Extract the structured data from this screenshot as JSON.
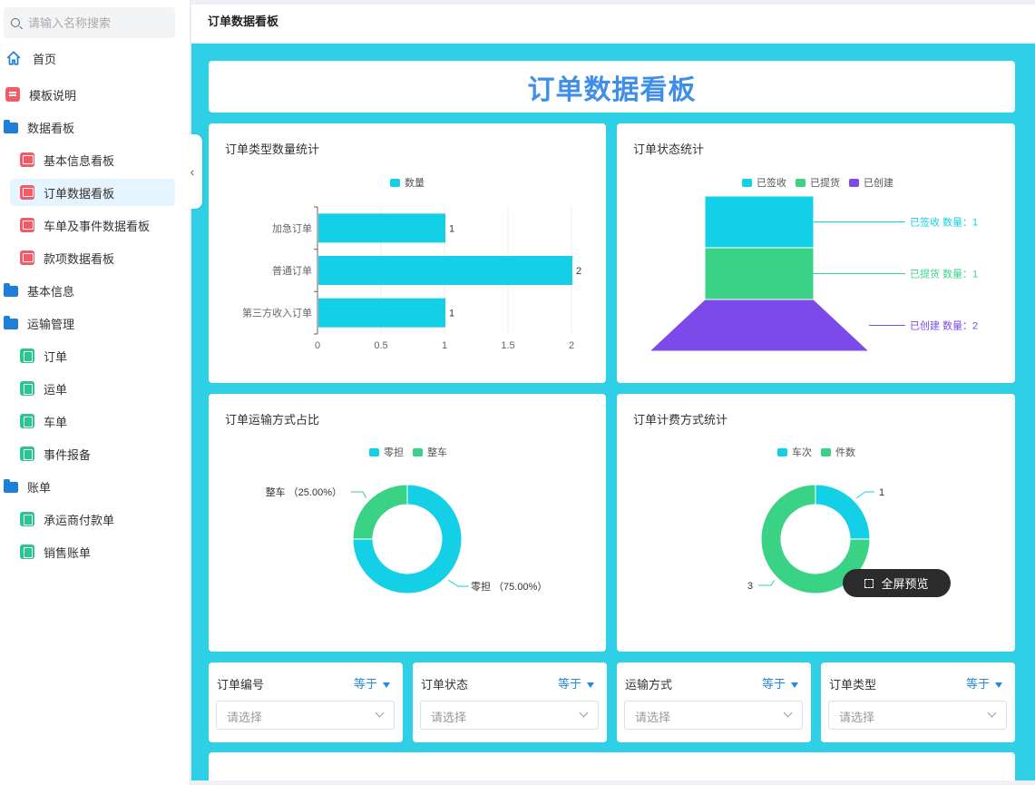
{
  "search": {
    "placeholder": "请输入名称搜索"
  },
  "sidebar": {
    "items": [
      {
        "label": "首页"
      },
      {
        "label": "模板说明"
      },
      {
        "label": "数据看板"
      },
      {
        "label": "基本信息看板"
      },
      {
        "label": "订单数据看板"
      },
      {
        "label": "车单及事件数据看板"
      },
      {
        "label": "款项数据看板"
      },
      {
        "label": "基本信息"
      },
      {
        "label": "运输管理"
      },
      {
        "label": "订单"
      },
      {
        "label": "运单"
      },
      {
        "label": "车单"
      },
      {
        "label": "事件报备"
      },
      {
        "label": "账单"
      },
      {
        "label": "承运商付款单"
      },
      {
        "label": "销售账单"
      }
    ],
    "collapse_glyph": "‹"
  },
  "header": {
    "title": "订单数据看板"
  },
  "dashboard": {
    "banner_title": "订单数据看板",
    "preview_label": "全屏预览"
  },
  "colors": {
    "cyan": "#14d0e6",
    "green": "#3ad386",
    "purple": "#7b4ae8",
    "accent": "#3f8ee8"
  },
  "chart_data": [
    {
      "type": "bar",
      "orientation": "horizontal",
      "title": "订单类型数量统计",
      "categories": [
        "加急订单",
        "普通订单",
        "第三方收入订单"
      ],
      "series": [
        {
          "name": "数量",
          "values": [
            1,
            2,
            1
          ]
        }
      ],
      "xticks": [
        "0",
        "0.5",
        "1",
        "1.5",
        "2"
      ],
      "xlim": [
        0,
        2
      ],
      "legend": "top-center"
    },
    {
      "type": "funnel",
      "title": "订单状态统计",
      "categories": [
        "已签收",
        "已提货",
        "已创建"
      ],
      "values": [
        1,
        1,
        2
      ],
      "labels": [
        "已签收 数量：1",
        "已提货 数量：1",
        "已创建 数量：2"
      ],
      "legend": "top-center"
    },
    {
      "type": "pie",
      "donut": true,
      "title": "订单运输方式占比",
      "categories": [
        "零担",
        "整车"
      ],
      "values": [
        75,
        25
      ],
      "labels": [
        "零担 （75.00%）",
        "整车 （25.00%）"
      ],
      "legend": "top-center"
    },
    {
      "type": "pie",
      "donut": true,
      "title": "订单计费方式统计",
      "categories": [
        "车次",
        "件数"
      ],
      "values": [
        1,
        3
      ],
      "labels": [
        "1",
        "3"
      ],
      "legend": "top-center"
    }
  ],
  "filters": [
    {
      "label": "订单编号",
      "operator": "等于",
      "placeholder": "请选择"
    },
    {
      "label": "订单状态",
      "operator": "等于",
      "placeholder": "请选择"
    },
    {
      "label": "运输方式",
      "operator": "等于",
      "placeholder": "请选择"
    },
    {
      "label": "订单类型",
      "operator": "等于",
      "placeholder": "请选择"
    }
  ]
}
